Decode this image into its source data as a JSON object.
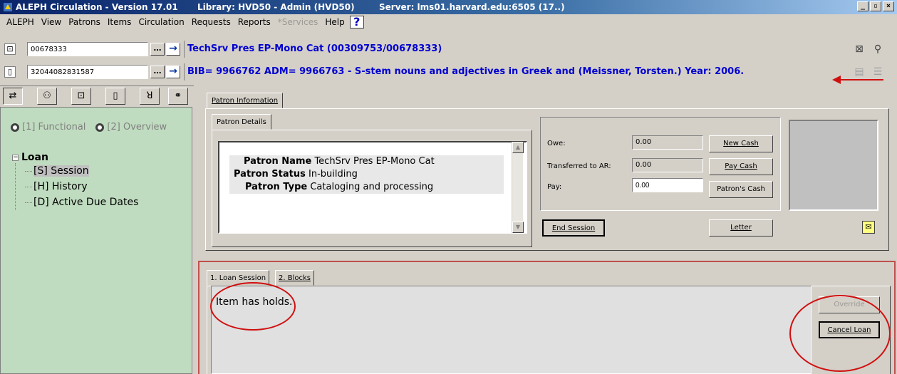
{
  "titlebar": {
    "app": "ALEPH Circulation - Version 17.01",
    "library": "Library: HVD50 - Admin (HVD50)",
    "server": "Server: lms01.harvard.edu:6505 (17..)"
  },
  "menu": [
    "ALEPH",
    "View",
    "Patrons",
    "Items",
    "Circulation",
    "Requests",
    "Reports",
    "*Services",
    "Help"
  ],
  "menu_disabled": "*Services",
  "patron_row": {
    "code": "00678333",
    "info": "TechSrv Pres EP-Mono Cat (00309753/00678333)"
  },
  "item_row": {
    "code": "32044082831587",
    "info": "BIB= 9966762 ADM= 9966763 - S-stem nouns and adjectives in Greek and (Meissner, Torsten.) Year: 2006."
  },
  "left": {
    "radio_functional": "[1] Functional",
    "radio_overview": "[2] Overview",
    "tree_root": "Loan",
    "tree_items": [
      "[S] Session",
      "[H] History",
      "[D] Active Due Dates"
    ]
  },
  "patron_info": {
    "tab": "Patron Information",
    "details_tab": "Patron Details",
    "rows": [
      {
        "label": "Patron Name",
        "value": "TechSrv Pres EP-Mono Cat"
      },
      {
        "label": "Patron Status",
        "value": "In-building"
      },
      {
        "label": "Patron Type",
        "value": "Cataloging and processing"
      }
    ]
  },
  "cash": {
    "owe_label": "Owe:",
    "owe_value": "0.00",
    "ar_label": "Transferred to AR:",
    "ar_value": "0.00",
    "pay_label": "Pay:",
    "pay_value": "0.00",
    "new_cash": "New Cash",
    "pay_cash": "Pay Cash",
    "patrons_cash": "Patron's Cash",
    "end_session": "End Session",
    "letter": "Letter"
  },
  "loan": {
    "tab1": "1. Loan Session",
    "tab2": "2. Blocks",
    "message": "Item has holds.",
    "override": "Override",
    "cancel_loan": "Cancel Loan"
  },
  "colors": {
    "info_text": "#0000d0",
    "annotation": "#d01010",
    "left_panel": "#c0dcc0"
  }
}
